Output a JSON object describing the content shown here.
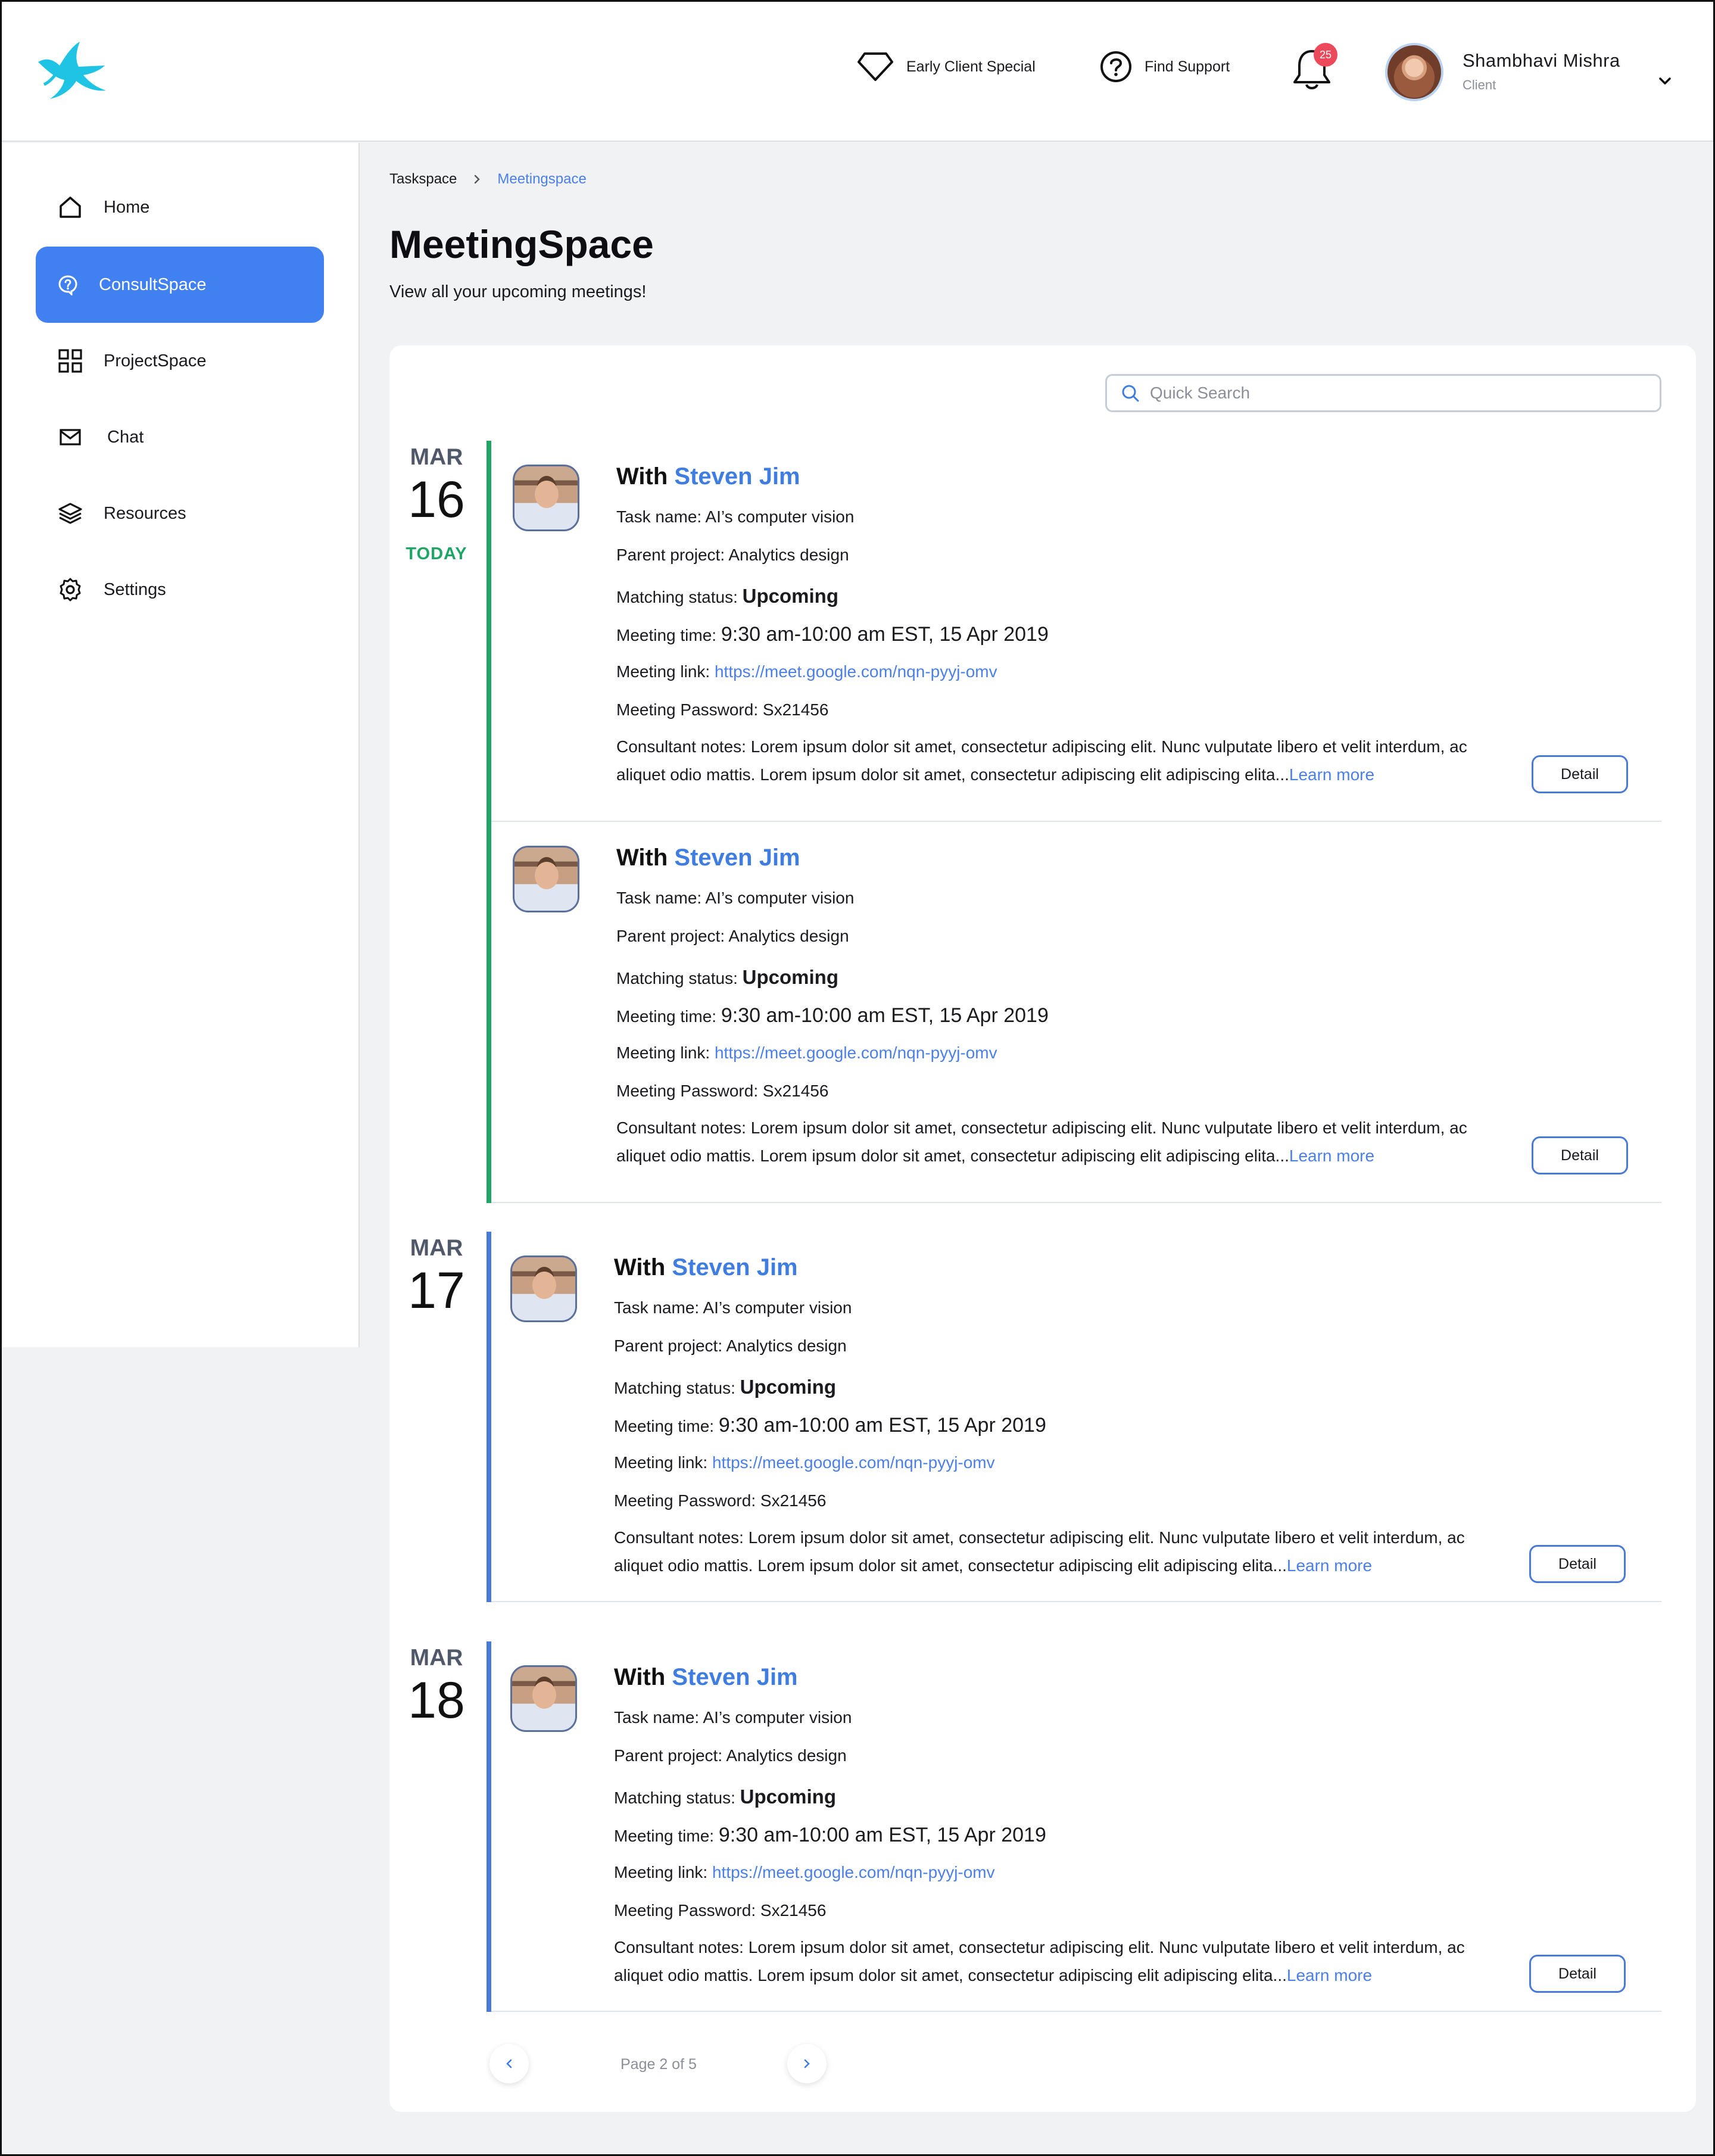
{
  "header": {
    "early_client_label": "Early Client Special",
    "find_support_label": "Find Support",
    "notification_count": "25",
    "user_name": "Shambhavi Mishra",
    "user_role": "Client"
  },
  "sidebar": {
    "items": [
      {
        "label": "Home",
        "icon": "home-icon"
      },
      {
        "label": "ConsultSpace",
        "icon": "question-bubble-icon",
        "active": true
      },
      {
        "label": "ProjectSpace",
        "icon": "grid-icon"
      },
      {
        "label": "Chat",
        "icon": "mail-icon"
      },
      {
        "label": "Resources",
        "icon": "layers-icon"
      },
      {
        "label": "Settings",
        "icon": "gear-icon"
      }
    ]
  },
  "breadcrumb": {
    "parent": "Taskspace",
    "current": "Meetingspace"
  },
  "page": {
    "title": "MeetingSpace",
    "subtitle": "View all your upcoming meetings!"
  },
  "search": {
    "placeholder": "Quick Search",
    "value": ""
  },
  "colors": {
    "accent": "#4080f0",
    "today": "#1fa565",
    "timeline_today": "#1fa565",
    "timeline_future": "#4a7ad8",
    "badge": "#ec4a5a"
  },
  "date_groups": [
    {
      "month": "MAR",
      "day": "16",
      "today_label": "TODAY"
    },
    {
      "month": "MAR",
      "day": "17"
    },
    {
      "month": "MAR",
      "day": "18"
    }
  ],
  "meetings": [
    {
      "with_prefix": "With",
      "consultant": "Steven Jim",
      "task_label": "Task name:",
      "task": "AI’s computer vision",
      "project_label": "Parent project:",
      "project": "Analytics design",
      "status_label": "Matching status:",
      "status": "Upcoming",
      "time_label": "Meeting time:",
      "time": "9:30 am-10:00 am EST, 15 Apr 2019",
      "link_label": "Meeting link:",
      "link": "https://meet.google.com/nqn-pyyj-omv",
      "password_label": "Meeting Password:",
      "password": "Sx21456",
      "notes_label": "Consultant notes:",
      "notes": "Lorem ipsum dolor sit amet, consectetur adipiscing elit. Nunc vulputate libero et velit interdum, ac aliquet odio mattis. Lorem ipsum dolor sit amet, consectetur adipiscing elit adipiscing elita...",
      "learn_more": "Learn more",
      "detail_label": "Detail"
    },
    {
      "with_prefix": "With",
      "consultant": "Steven Jim",
      "task_label": "Task name:",
      "task": "AI’s computer vision",
      "project_label": "Parent project:",
      "project": "Analytics design",
      "status_label": "Matching status:",
      "status": "Upcoming",
      "time_label": "Meeting time:",
      "time": "9:30 am-10:00 am EST, 15 Apr 2019",
      "link_label": "Meeting link:",
      "link": "https://meet.google.com/nqn-pyyj-omv",
      "password_label": "Meeting Password:",
      "password": "Sx21456",
      "notes_label": "Consultant  notes:",
      "notes": "Lorem ipsum dolor sit amet, consectetur adipiscing elit. Nunc vulputate libero et velit interdum, ac aliquet odio mattis. Lorem ipsum dolor sit amet, consectetur adipiscing elit adipiscing elita...",
      "learn_more": "Learn more",
      "detail_label": "Detail"
    },
    {
      "with_prefix": "With",
      "consultant": "Steven Jim",
      "task_label": "Task name:",
      "task": "AI’s computer vision",
      "project_label": "Parent project:",
      "project": "Analytics design",
      "status_label": "Matching status:",
      "status": "Upcoming",
      "time_label": "Meeting time:",
      "time": "9:30 am-10:00 am EST, 15 Apr 2019",
      "link_label": "Meeting link:",
      "link": "https://meet.google.com/nqn-pyyj-omv",
      "password_label": "Meeting Password:",
      "password": "Sx21456",
      "notes_label": "Consultant notes:",
      "notes": "Lorem ipsum dolor sit amet, consectetur adipiscing elit. Nunc vulputate libero et velit interdum, ac aliquet odio mattis. Lorem ipsum dolor sit amet, consectetur adipiscing elit adipiscing elita...",
      "learn_more": "Learn more",
      "detail_label": "Detail"
    },
    {
      "with_prefix": "With",
      "consultant": "Steven Jim",
      "task_label": "Task name:",
      "task": "AI’s computer vision",
      "project_label": "Parent project:",
      "project": "Analytics design",
      "status_label": "Matching status:",
      "status": "Upcoming",
      "time_label": "Meeting time:",
      "time": "9:30 am-10:00 am EST, 15 Apr 2019",
      "link_label": "Meeting link:",
      "link": "https://meet.google.com/nqn-pyyj-omv",
      "password_label": "Meeting Password:",
      "password": "Sx21456",
      "notes_label": "Consultant notes:",
      "notes": "Lorem ipsum dolor sit amet, consectetur adipiscing elit. Nunc vulputate libero et velit interdum, ac aliquet odio mattis. Lorem ipsum dolor sit amet, consectetur adipiscing elit adipiscing elita...",
      "learn_more": "Learn more",
      "detail_label": "Detail"
    }
  ],
  "pagination": {
    "label": "Page 2 of 5",
    "current": 2,
    "total": 5
  }
}
